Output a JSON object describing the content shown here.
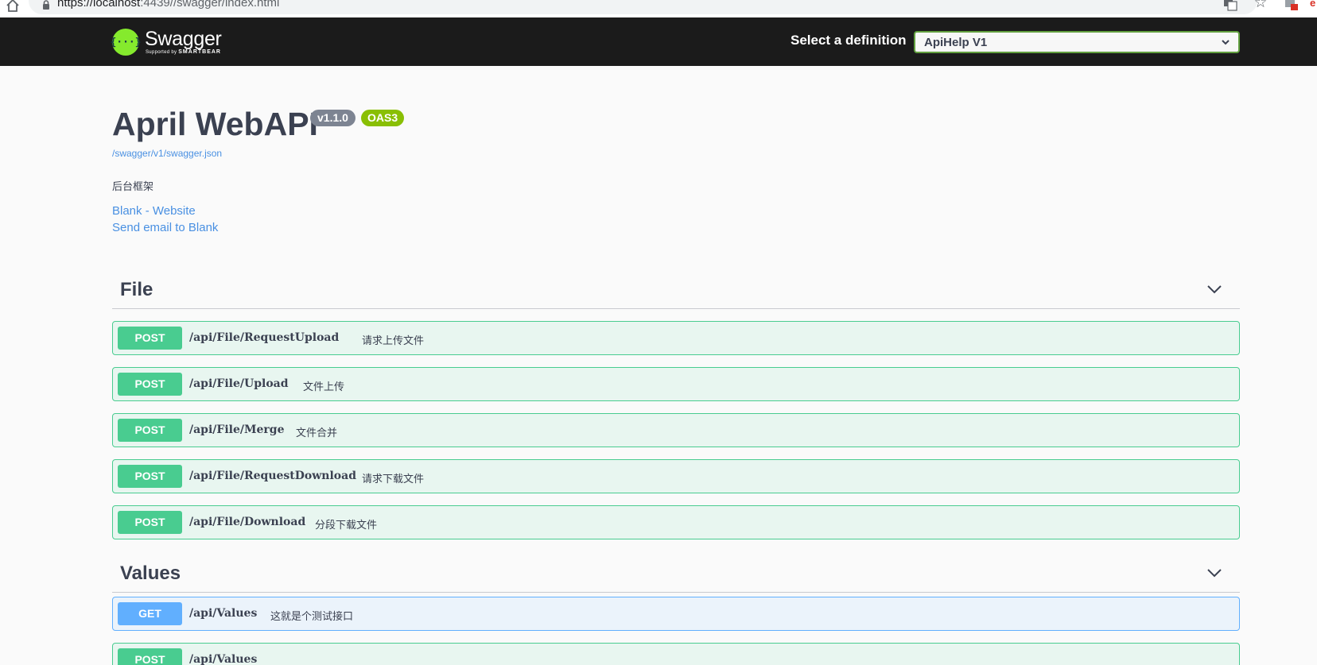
{
  "browser": {
    "url_host": "https://localhost",
    "url_rest": ":4439//swagger/index.html"
  },
  "topbar": {
    "logo_icon_text": "{···}",
    "logo_name": "Swagger",
    "logo_sub_prefix": "Supported by",
    "logo_sub_brand": "SMARTBEAR",
    "definition_label": "Select a definition",
    "definition_value": "ApiHelp V1"
  },
  "info": {
    "title": "April WebAPI",
    "version": "v1.1.0",
    "oas": "OAS3",
    "spec_url": "/swagger/v1/swagger.json",
    "description": "后台框架",
    "website_link": "Blank - Website",
    "email_link": "Send email to Blank"
  },
  "tags": [
    {
      "name": "File",
      "operations": [
        {
          "method": "POST",
          "path": "/api/File/RequestUpload",
          "summary": "请求上传文件"
        },
        {
          "method": "POST",
          "path": "/api/File/Upload",
          "summary": "文件上传"
        },
        {
          "method": "POST",
          "path": "/api/File/Merge",
          "summary": "文件合并"
        },
        {
          "method": "POST",
          "path": "/api/File/RequestDownload",
          "summary": "请求下载文件"
        },
        {
          "method": "POST",
          "path": "/api/File/Download",
          "summary": "分段下载文件"
        }
      ]
    },
    {
      "name": "Values",
      "operations": [
        {
          "method": "GET",
          "path": "/api/Values",
          "summary": "这就是个测试接口"
        },
        {
          "method": "POST",
          "path": "/api/Values",
          "summary": ""
        }
      ]
    }
  ],
  "colors": {
    "post": "#49cc90",
    "get": "#61affe",
    "topbar": "#1b1b1b",
    "swagger_green": "#85ea2d",
    "link": "#4990e2"
  }
}
